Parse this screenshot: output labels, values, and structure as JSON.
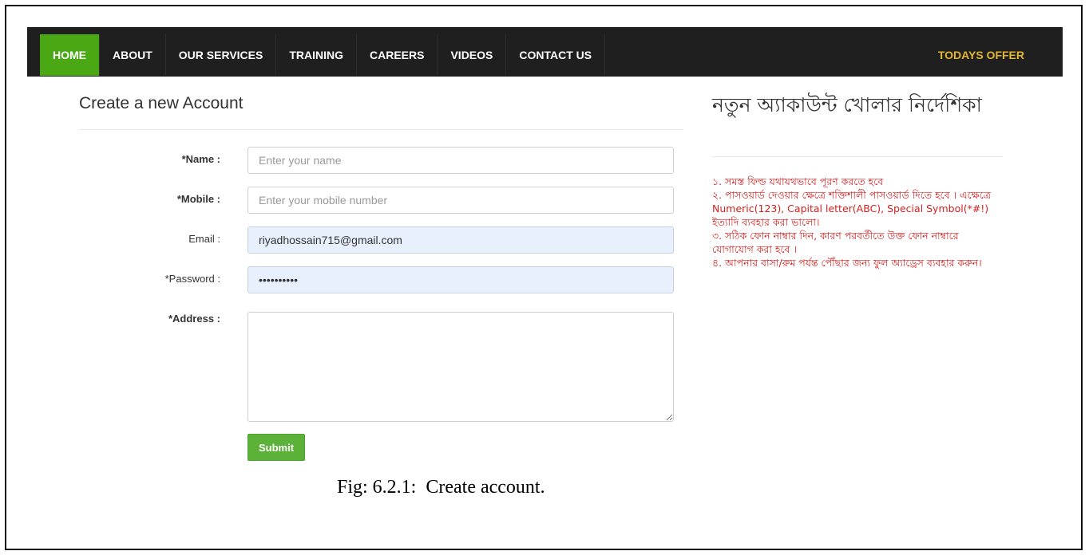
{
  "navbar": {
    "items": [
      {
        "label": "HOME",
        "active": true
      },
      {
        "label": "ABOUT",
        "active": false
      },
      {
        "label": "OUR SERVICES",
        "active": false
      },
      {
        "label": "TRAINING",
        "active": false
      },
      {
        "label": "CAREERS",
        "active": false
      },
      {
        "label": "VIDEOS",
        "active": false
      },
      {
        "label": "CONTACT US",
        "active": false
      }
    ],
    "offer_label": "TODAYS OFFER",
    "colors": {
      "background": "#1f1f1f",
      "active": "#49a814",
      "offer": "#e2b634"
    }
  },
  "form": {
    "title": "Create a new Account",
    "fields": {
      "name": {
        "label": "*Name :",
        "placeholder": "Enter your name",
        "value": ""
      },
      "mobile": {
        "label": "*Mobile :",
        "placeholder": "Enter your mobile number",
        "value": ""
      },
      "email": {
        "label": "Email :",
        "placeholder": "",
        "value": "riyadhossain715@gmail.com"
      },
      "password": {
        "label": "*Password :",
        "placeholder": "",
        "value": "••••••••••"
      },
      "address": {
        "label": "*Address :",
        "placeholder": "",
        "value": ""
      }
    },
    "submit_label": "Submit",
    "submit_color": "#5cb239"
  },
  "instructions": {
    "title": "নতুন অ্যাকাউন্ট খোলার নির্দেশিকা",
    "items": [
      "১. সমস্ত ফিল্ড যথাযথভাবে পূরণ করতে হবে",
      "২. পাসওয়ার্ড দেওয়ার ক্ষেত্রে শক্তিশালী পাসওয়ার্ড দিতে হবে । এক্ষেত্রে Numeric(123), Capital letter(ABC), Special Symbol(*#!) ইত্যাদি ব্যবহার করা ভালো।",
      "৩. সঠিক ফোন নাম্বার দিন, কারণ পরবর্তীতে উক্ত ফোন নাম্বারে যোগাযোগ করা হবে ।",
      "৪. আপনার বাসা/রুম পর্যন্ত পৌঁছার জন্য ফুল অ্যাড্রেস ব্যবহার করুন।"
    ],
    "text_color": "#d41f1f"
  },
  "caption": "Fig: 6.2.1:  Create account."
}
